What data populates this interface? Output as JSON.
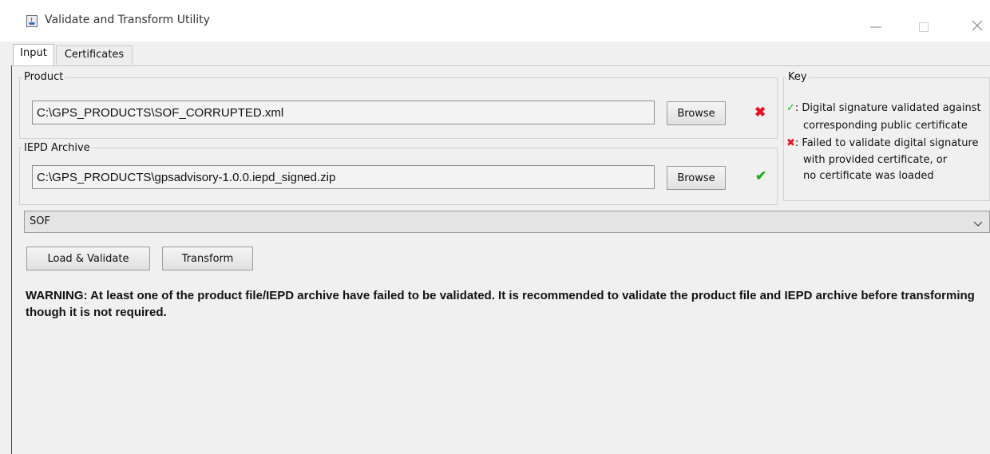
{
  "window": {
    "title": "Validate and Transform Utility",
    "icon": "java-app-icon",
    "controls": [
      "minimize-icon",
      "maximize-icon",
      "close-icon"
    ]
  },
  "tabs": [
    {
      "label": "Input",
      "selected": true
    },
    {
      "label": "Certificates",
      "selected": false
    }
  ],
  "product": {
    "label": "Product",
    "path": "C:\\GPS_PRODUCTS\\SOF_CORRUPTED.xml",
    "browse_label": "Browse",
    "status_icon": "red-x-icon",
    "status_glyph": "✖"
  },
  "iepd": {
    "label": "IEPD Archive",
    "path": "C:\\GPS_PRODUCTS\\gpsadvisory-1.0.0.iepd_signed.zip",
    "browse_label": "Browse",
    "status_icon": "green-check-icon",
    "status_glyph": "✔"
  },
  "key": {
    "label": "Key",
    "valid_mark": "✓",
    "valid_line1": ": Digital signature validated against",
    "valid_line2": "corresponding public certificate",
    "invalid_mark": "✖",
    "invalid_line1": ": Failed to validate digital signature",
    "invalid_line2": "with provided certificate, or",
    "invalid_line3": "no certificate was loaded"
  },
  "type_select": {
    "value": "SOF"
  },
  "actions": {
    "load_validate_label": "Load & Validate",
    "transform_label": "Transform"
  },
  "warning": {
    "text": "WARNING: At least one of the product file/IEPD archive have failed to be validated. It is recommended to validate the product file and IEPD archive before transforming though it is not required."
  },
  "colors": {
    "error": "#e81123",
    "ok": "#1eb11e",
    "background": "#f0f0f0"
  }
}
